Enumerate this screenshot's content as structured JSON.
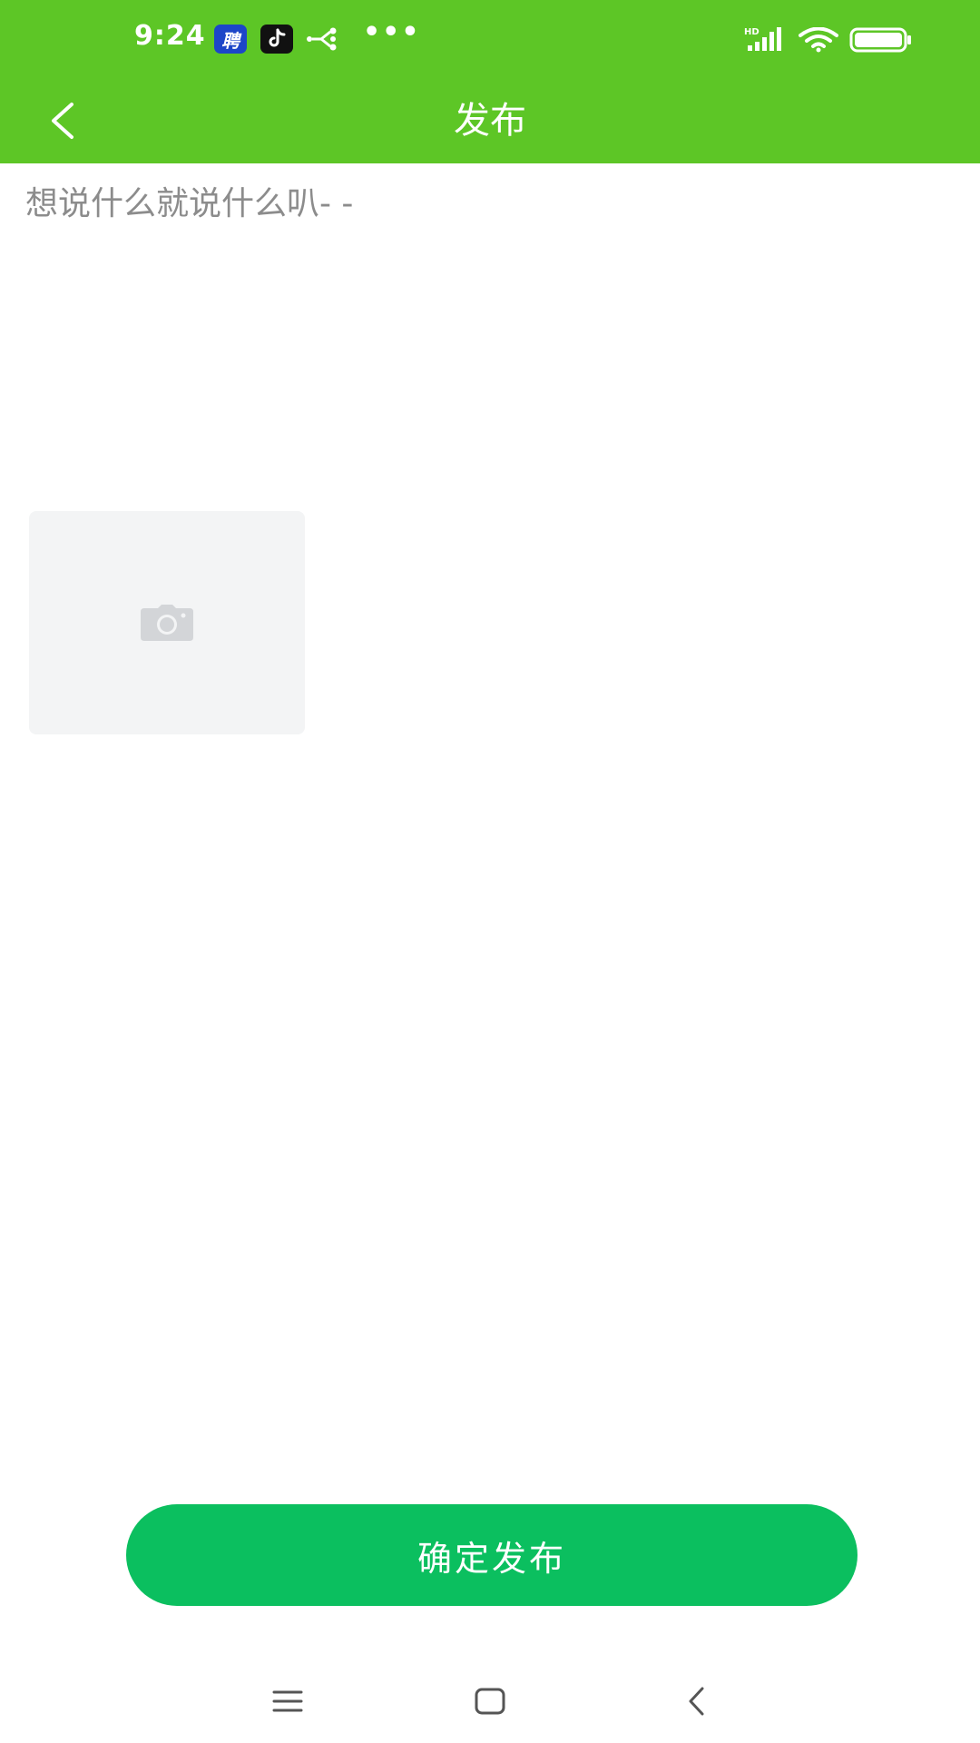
{
  "status_bar": {
    "time": "9:24",
    "notification_icons": [
      "recruit-app-icon",
      "tiktok-icon",
      "share-icon",
      "more-dots-icon"
    ],
    "recruit_glyph": "聘",
    "more": "•••",
    "system_icons": [
      "signal-icon",
      "wifi-icon",
      "battery-icon"
    ],
    "signal_label": "HD"
  },
  "header": {
    "title": "发布",
    "back_icon": "chevron-left-icon",
    "background_color": "#5dc626"
  },
  "post": {
    "placeholder": "想说什么就说什么叭- -",
    "value": ""
  },
  "photo_picker": {
    "icon": "camera-icon"
  },
  "actions": {
    "publish_label": "确定发布",
    "publish_color": "#0bbf5f"
  },
  "nav_bar": {
    "items": [
      "menu-icon",
      "home-icon",
      "back-icon"
    ]
  }
}
